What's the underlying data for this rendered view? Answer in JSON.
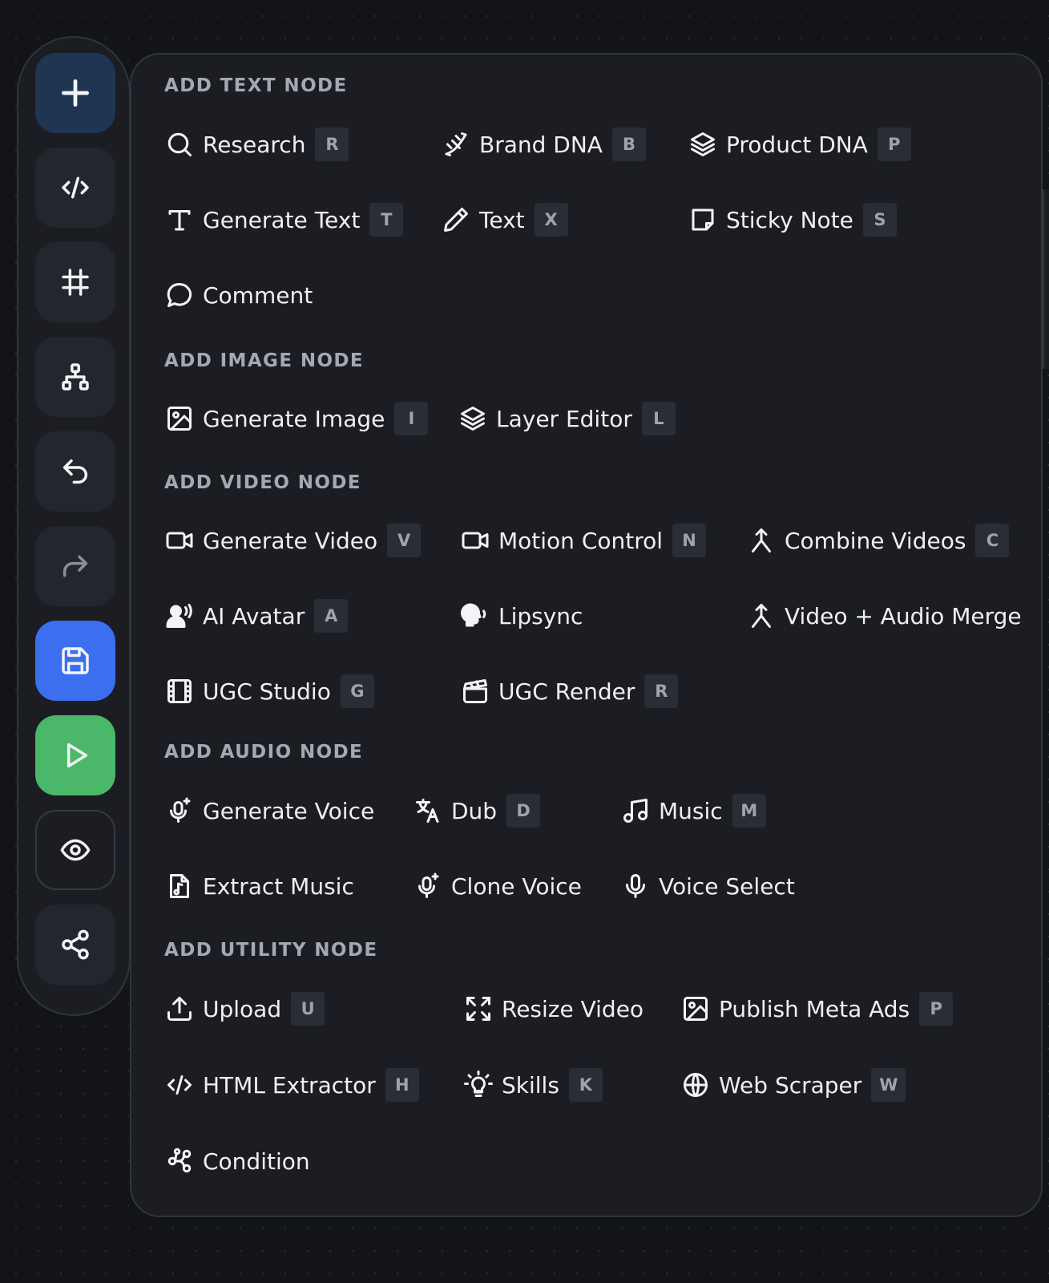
{
  "toolbar": {
    "buttons": [
      {
        "name": "add-node-button",
        "icon": "plus-icon"
      },
      {
        "name": "code-button",
        "icon": "code-icon"
      },
      {
        "name": "frame-button",
        "icon": "frame-icon"
      },
      {
        "name": "structure-button",
        "icon": "hierarchy-icon"
      },
      {
        "name": "undo-button",
        "icon": "undo-icon"
      },
      {
        "name": "redo-button",
        "icon": "redo-icon"
      },
      {
        "name": "save-button",
        "icon": "floppy-disk-icon",
        "color": "#3b6ff0"
      },
      {
        "name": "run-button",
        "icon": "play-icon",
        "color": "#4ab868"
      },
      {
        "name": "preview-button",
        "icon": "eye-icon"
      },
      {
        "name": "share-button",
        "icon": "share-icon"
      }
    ]
  },
  "menu": {
    "text_section": {
      "title": "ADD TEXT NODE",
      "items": [
        {
          "label": "Research",
          "key": "R",
          "icon": "search-icon"
        },
        {
          "label": "Brand DNA",
          "key": "B",
          "icon": "dna-icon"
        },
        {
          "label": "Product DNA",
          "key": "P",
          "icon": "layers-icon"
        },
        {
          "label": "Generate Text",
          "key": "T",
          "icon": "type-icon"
        },
        {
          "label": "Text",
          "key": "X",
          "icon": "pencil-icon"
        },
        {
          "label": "Sticky Note",
          "key": "S",
          "icon": "sticky-note-icon"
        },
        {
          "label": "Comment",
          "icon": "comment-icon"
        }
      ]
    },
    "image_section": {
      "title": "ADD IMAGE NODE",
      "items": [
        {
          "label": "Generate Image",
          "key": "I",
          "icon": "image-icon"
        },
        {
          "label": "Layer Editor",
          "key": "L",
          "icon": "layers-icon"
        }
      ]
    },
    "video_section": {
      "title": "ADD VIDEO NODE",
      "items": [
        {
          "label": "Generate Video",
          "key": "V",
          "icon": "video-camera-icon"
        },
        {
          "label": "Motion Control",
          "key": "N",
          "icon": "video-camera-icon"
        },
        {
          "label": "Combine Videos",
          "key": "C",
          "icon": "merge-icon"
        },
        {
          "label": "AI Avatar",
          "key": "A",
          "icon": "speaking-person-icon"
        },
        {
          "label": "Lipsync",
          "icon": "speaking-head-icon"
        },
        {
          "label": "Video + Audio Merge",
          "icon": "merge-icon"
        },
        {
          "label": "UGC Studio",
          "key": "G",
          "icon": "film-icon"
        },
        {
          "label": "UGC Render",
          "key": "R",
          "icon": "clapperboard-icon"
        }
      ]
    },
    "audio_section": {
      "title": "ADD AUDIO NODE",
      "items": [
        {
          "label": "Generate Voice",
          "icon": "mic-sparkle-icon"
        },
        {
          "label": "Dub",
          "key": "D",
          "icon": "translate-icon"
        },
        {
          "label": "Music",
          "key": "M",
          "icon": "music-note-icon"
        },
        {
          "label": "Extract Music",
          "icon": "music-file-icon"
        },
        {
          "label": "Clone Voice",
          "icon": "mic-sparkle-icon"
        },
        {
          "label": "Voice Select",
          "icon": "mic-icon"
        }
      ]
    },
    "utility_section": {
      "title": "ADD UTILITY NODE",
      "items": [
        {
          "label": "Upload",
          "key": "U",
          "icon": "upload-icon"
        },
        {
          "label": "Resize Video",
          "icon": "resize-icon"
        },
        {
          "label": "Publish Meta Ads",
          "key": "P",
          "icon": "image-icon"
        },
        {
          "label": "HTML Extractor",
          "key": "H",
          "icon": "code-icon"
        },
        {
          "label": "Skills",
          "key": "K",
          "icon": "lightbulb-icon"
        },
        {
          "label": "Web Scraper",
          "key": "W",
          "icon": "globe-icon"
        },
        {
          "label": "Condition",
          "icon": "flow-icon"
        }
      ]
    }
  }
}
